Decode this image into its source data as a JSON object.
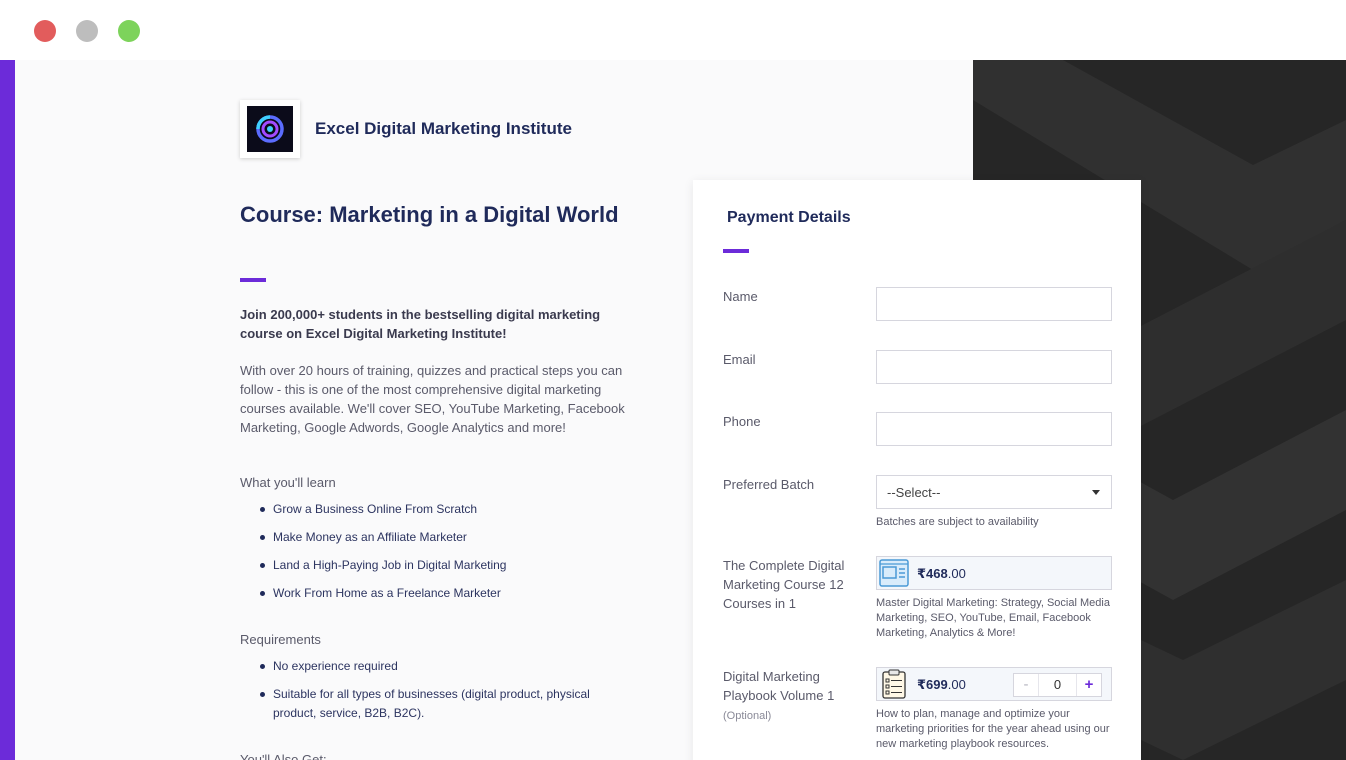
{
  "window": {
    "controls": [
      "close",
      "minimize",
      "maximize"
    ]
  },
  "brand": {
    "name": "Excel Digital Marketing Institute",
    "logo_icon": "swirl-logo-icon"
  },
  "course": {
    "title": "Course: Marketing in a Digital World",
    "intro_bold": "Join 200,000+ students in the bestselling digital marketing course on Excel Digital Marketing Institute!",
    "intro": "With over 20 hours of training, quizzes and practical steps you can follow - this is one of the most comprehensive digital marketing courses available. We'll cover SEO, YouTube Marketing, Facebook Marketing, Google Adwords, Google Analytics and more!",
    "learn_heading": "What you'll learn",
    "learn_items": [
      "Grow a Business Online From Scratch",
      "Make Money as an Affiliate Marketer",
      "Land a High-Paying Job in Digital Marketing",
      "Work From Home as a Freelance Marketer"
    ],
    "requirements_heading": "Requirements",
    "requirements_items": [
      "No experience required",
      "Suitable for all types of businesses (digital product, physical product, service, B2B, B2C)."
    ],
    "also_get_heading": "You'll Also Get:"
  },
  "payment": {
    "title": "Payment Details",
    "name_label": "Name",
    "name_value": "",
    "email_label": "Email",
    "email_value": "",
    "phone_label": "Phone",
    "phone_value": "",
    "batch_label": "Preferred Batch",
    "batch_selected": "--Select--",
    "batch_help": "Batches are subject to availability",
    "product1": {
      "label": "The Complete Digital Marketing Course 12 Courses in 1",
      "currency": "₹",
      "price_main": "468",
      "price_decimals": ".00",
      "description": "Master Digital Marketing: Strategy, Social Media Marketing, SEO, YouTube, Email, Facebook Marketing, Analytics & More!"
    },
    "product2": {
      "label": "Digital Marketing Playbook Volume 1",
      "optional": "(Optional)",
      "currency": "₹",
      "price_main": "699",
      "price_decimals": ".00",
      "quantity": "0",
      "minus": "-",
      "plus": "+",
      "description": "How to plan, manage and optimize your marketing priorities for the year ahead using our new marketing playbook resources."
    }
  },
  "colors": {
    "accent": "#6c2bd9",
    "navy": "#1f2a5a",
    "dark_panel": "#2a2a2a"
  }
}
